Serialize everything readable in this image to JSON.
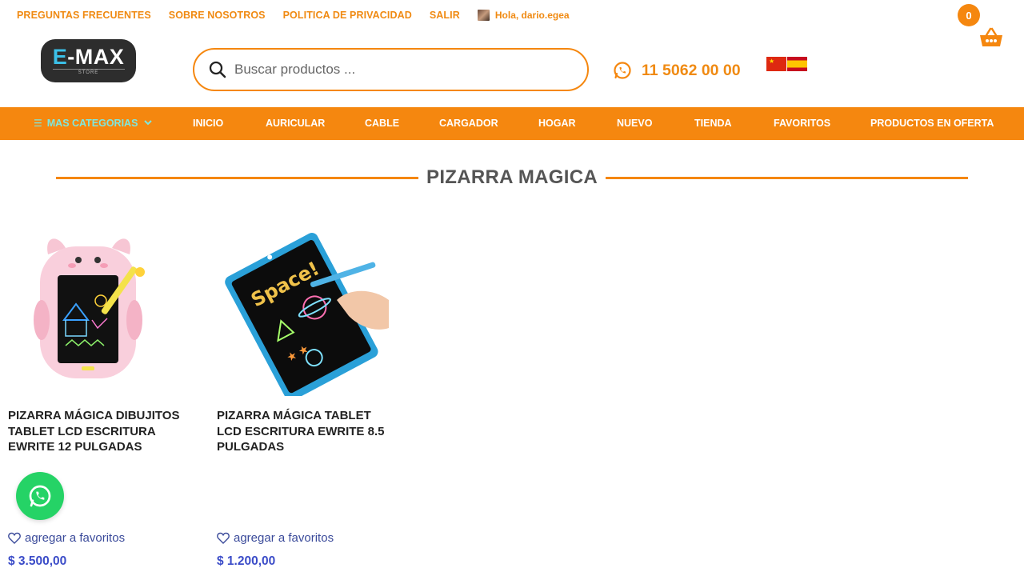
{
  "top_links": [
    "PREGUNTAS FRECUENTES",
    "SOBRE NOSOTROS",
    "POLITICA DE PRIVACIDAD",
    "SALIR"
  ],
  "user_greeting": "Hola, dario.egea",
  "cart": {
    "count": "0",
    "icon": "basket-icon"
  },
  "logo": {
    "brand_e": "E",
    "brand_rest": "-MAX",
    "sub": "STORE"
  },
  "search": {
    "placeholder": "Buscar productos ...",
    "icon": "search-icon"
  },
  "phone": {
    "number": "11 5062 00 00",
    "icon": "whatsapp-icon"
  },
  "flags": [
    "china-flag",
    "spain-flag"
  ],
  "nav": {
    "categories_label": "MAS CATEGORIAS",
    "items": [
      "INICIO",
      "AURICULAR",
      "CABLE",
      "CARGADOR",
      "HOGAR",
      "NUEVO",
      "TIENDA",
      "FAVORITOS",
      "PRODUCTOS EN OFERTA"
    ]
  },
  "page_title": "PIZARRA MAGICA",
  "products": [
    {
      "title": "PIZARRA MÁGICA DIBUJITOS TABLET LCD ESCRITURA EWRITE 12 PULGADAS",
      "fav": "agregar a favoritos",
      "price": "$ 3.500,00"
    },
    {
      "title": "PIZARRA MÁGICA TABLET LCD ESCRITURA EWRITE 8.5 PULGADAS",
      "fav": "agregar a favoritos",
      "price": "$ 1.200,00"
    }
  ],
  "colors": {
    "accent": "#f5870f",
    "link": "#3a4a9a",
    "price": "#3b4cc8",
    "whatsapp": "#25d366"
  }
}
